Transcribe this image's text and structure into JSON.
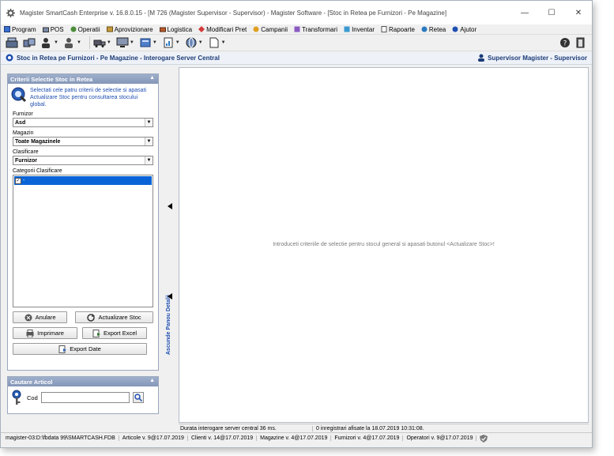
{
  "window": {
    "title": "Magister SmartCash Enterprise v. 16.8.0.15 - [M 726 (Magister Supervisor - Supervisor) - Magister Software - [Stoc in Retea pe Furnizori - Pe Magazine]",
    "controls": {
      "minimize": "—",
      "maximize": "☐",
      "close": "✕"
    }
  },
  "menu": {
    "items": [
      {
        "label": "Program"
      },
      {
        "label": "POS"
      },
      {
        "label": "Operatii"
      },
      {
        "label": "Aprovizionare"
      },
      {
        "label": "Logistica"
      },
      {
        "label": "Modificari Pret"
      },
      {
        "label": "Campanii"
      },
      {
        "label": "Transformari"
      },
      {
        "label": "Inventar"
      },
      {
        "label": "Rapoarte"
      },
      {
        "label": "Retea"
      },
      {
        "label": "Ajutor"
      }
    ]
  },
  "breadcrumb": {
    "text": "Stoc in Retea pe Furnizori - Pe Magazine - Interogare Server Central",
    "user": "Supervisor Magister - Supervisor"
  },
  "filters": {
    "header": "Criterii Selectie Stoc in Retea",
    "info": "Selectati cele patru criterii de selectie si apasati Actualizare Stoc pentru consultarea stocului global.",
    "furnizor": {
      "label": "Furnizor",
      "value": "Asd"
    },
    "magazin": {
      "label": "Magazin",
      "value": "Toate Magazinele"
    },
    "clasificare": {
      "label": "Clasificare",
      "value": "Furnizor"
    },
    "categorii": {
      "label": "Categorii Clasificare",
      "items": [
        {
          "label": "-",
          "checked": true
        }
      ]
    }
  },
  "buttons": {
    "anulare": "Anulare",
    "actualizare": "Actualizare Stoc",
    "imprimare": "Imprimare",
    "export_excel": "Export Excel",
    "export_date": "Export Date"
  },
  "cautare": {
    "header": "Cautare Articol",
    "label": "Cod",
    "value": ""
  },
  "splitter": {
    "label": "Ascunde Panou Detalii"
  },
  "content": {
    "message": "Introduceti criteriile de selectie pentru stocul general si apasati butonul <Actualizare Stoc>!"
  },
  "content_status": {
    "durata": "Durata interogare server central 36 ms.",
    "inregistrari": "0 inregistrari afisate la 18.07.2019 10:31:08."
  },
  "statusbar": {
    "segments": [
      "magister-03:D:\\fbdata 99\\SMARTCASH.FDB",
      "Articole v. 9@17.07.2019",
      "Clienti v. 14@17.07.2019",
      "Magazine v. 4@17.07.2019",
      "Furnizori v. 4@17.07.2019",
      "Operatori v. 9@17.07.2019"
    ]
  }
}
